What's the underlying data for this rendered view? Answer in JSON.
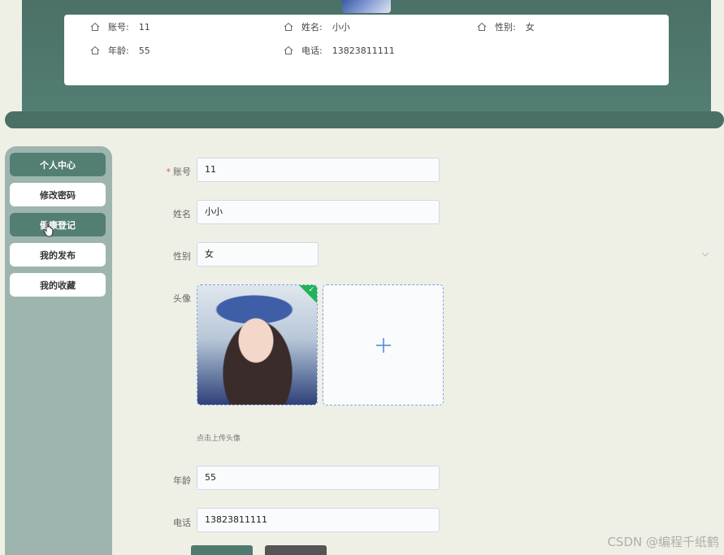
{
  "profile": {
    "account_label": "账号:",
    "account_value": "11",
    "name_label": "姓名:",
    "name_value": "小小",
    "gender_label": "性别:",
    "gender_value": "女",
    "age_label": "年龄:",
    "age_value": "55",
    "phone_label": "电话:",
    "phone_value": "13823811111"
  },
  "sidebar": {
    "items": [
      {
        "label": "个人中心",
        "active": true
      },
      {
        "label": "修改密码",
        "active": false
      },
      {
        "label": "健康登记",
        "active": true
      },
      {
        "label": "我的发布",
        "active": false
      },
      {
        "label": "我的收藏",
        "active": false
      }
    ]
  },
  "form": {
    "account_label": "账号",
    "account_value": "11",
    "name_label": "姓名",
    "name_value": "小小",
    "gender_label": "性别",
    "gender_value": "女",
    "avatar_label": "头像",
    "avatar_hint": "点击上传头像",
    "age_label": "年龄",
    "age_value": "55",
    "phone_label": "电话",
    "phone_value": "13823811111"
  },
  "watermark": "CSDN @编程千纸鹤",
  "colors": {
    "brand": "#537e74",
    "sidebar": "#9db5ae",
    "background": "#eef0e6",
    "success": "#22b357"
  }
}
